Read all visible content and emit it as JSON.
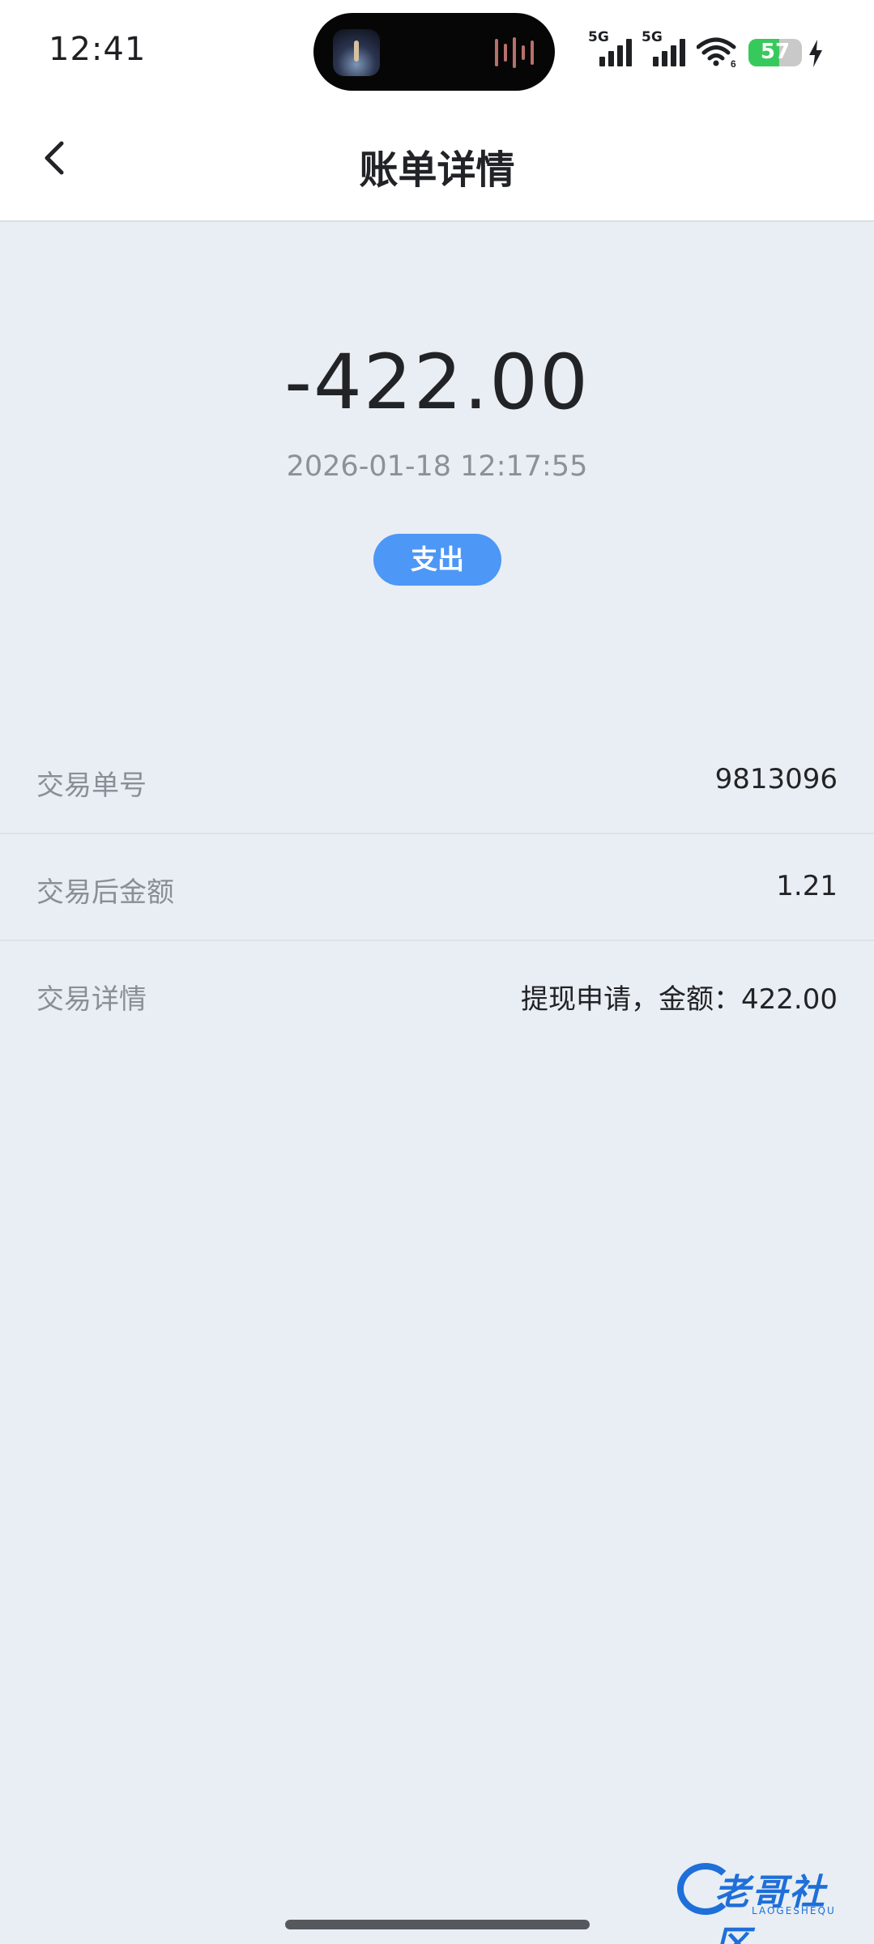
{
  "status_bar": {
    "time": "12:41",
    "signal_1_label": "5G",
    "signal_2_label": "5G",
    "wifi_badge": "6",
    "battery_level": "57",
    "battery_color": "#38c95c",
    "icons": [
      "music-player-thumbnail",
      "signal-icon",
      "wifi-icon",
      "battery-icon",
      "charging-bolt-icon"
    ]
  },
  "nav": {
    "title": "账单详情",
    "back_icon": "chevron-left-icon"
  },
  "summary": {
    "amount": "-422.00",
    "datetime": "2026-01-18 12:17:55",
    "type_label": "支出",
    "type_color": "#4d97f6"
  },
  "details": [
    {
      "label": "交易单号",
      "value": "9813096"
    },
    {
      "label": "交易后金额",
      "value": "1.21"
    },
    {
      "label": "交易详情",
      "value": "提现申请，金额：422.00"
    }
  ],
  "watermark": {
    "text": "老哥社区",
    "subtext": "LAOGESHEQU"
  }
}
